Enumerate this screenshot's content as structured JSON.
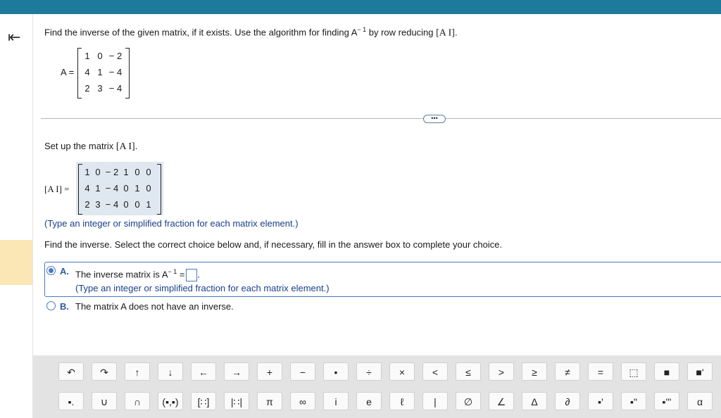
{
  "prompt": {
    "text_before": "Find the inverse of the given matrix, if it exists. Use the algorithm for finding A",
    "superscript": "− 1",
    "text_middle": " by row reducing ",
    "bracket_ai": "[A I]",
    "text_end": "."
  },
  "matrix_a": {
    "label": "A =",
    "rows": [
      [
        "1",
        "0",
        "− 2"
      ],
      [
        "4",
        "1",
        "− 4"
      ],
      [
        "2",
        "3",
        "− 4"
      ]
    ]
  },
  "setup": {
    "heading": "Set up the matrix ",
    "heading_math": "[A I]",
    "heading_end": ".",
    "label": "[A I] =",
    "rows": [
      [
        "1",
        "0",
        "− 2",
        "1",
        "0",
        "0"
      ],
      [
        "4",
        "1",
        "− 4",
        "0",
        "1",
        "0"
      ],
      [
        "2",
        "3",
        "− 4",
        "0",
        "0",
        "1"
      ]
    ],
    "hint": "(Type an integer or simplified fraction for each matrix element.)"
  },
  "find": {
    "instruction": "Find the inverse. Select the correct choice below and, if necessary, fill in the answer box to complete your choice."
  },
  "choices": [
    {
      "letter": "A.",
      "text": "The inverse matrix is A",
      "sup": "− 1",
      "eq": " =",
      "hint": "(Type an integer or simplified fraction for each matrix element.)",
      "selected": true
    },
    {
      "letter": "B.",
      "text": "The matrix A does not have an inverse.",
      "selected": false
    }
  ],
  "ellipsis": "•••",
  "toolbar_row1": [
    {
      "name": "undo-icon",
      "glyph": "↶"
    },
    {
      "name": "redo-icon",
      "glyph": "↷"
    },
    {
      "name": "arrow-up-icon",
      "glyph": "↑"
    },
    {
      "name": "arrow-down-icon",
      "glyph": "↓"
    },
    {
      "name": "arrow-left-icon",
      "glyph": "←"
    },
    {
      "name": "arrow-right-icon",
      "glyph": "→"
    },
    {
      "name": "plus-button",
      "glyph": "+"
    },
    {
      "name": "minus-button",
      "glyph": "−"
    },
    {
      "name": "dot-button",
      "glyph": "•"
    },
    {
      "name": "divide-button",
      "glyph": "÷"
    },
    {
      "name": "times-button",
      "glyph": "×"
    },
    {
      "name": "less-than-button",
      "glyph": "<"
    },
    {
      "name": "less-equal-button",
      "glyph": "≤"
    },
    {
      "name": "greater-than-button",
      "glyph": ">"
    },
    {
      "name": "greater-equal-button",
      "glyph": "≥"
    },
    {
      "name": "not-equal-button",
      "glyph": "≠"
    },
    {
      "name": "equals-button",
      "glyph": "="
    },
    {
      "name": "fraction-icon",
      "glyph": "⬚"
    },
    {
      "name": "mixed-number-icon",
      "glyph": "■"
    },
    {
      "name": "exponent-icon",
      "glyph": "■'"
    }
  ],
  "toolbar_row2": [
    {
      "name": "subscript-icon",
      "glyph": "▪."
    },
    {
      "name": "union-button",
      "glyph": "∪"
    },
    {
      "name": "intersection-button",
      "glyph": "∩"
    },
    {
      "name": "ordered-pair-button",
      "glyph": "(▪,▪)"
    },
    {
      "name": "matrix-icon",
      "glyph": "[∷]"
    },
    {
      "name": "determinant-icon",
      "glyph": "|∷|"
    },
    {
      "name": "pi-button",
      "glyph": "π"
    },
    {
      "name": "infinity-button",
      "glyph": "∞"
    },
    {
      "name": "imaginary-i-button",
      "glyph": "i"
    },
    {
      "name": "e-button",
      "glyph": "e"
    },
    {
      "name": "ell-button",
      "glyph": "ℓ"
    },
    {
      "name": "bar-button",
      "glyph": "|"
    },
    {
      "name": "empty-set-button",
      "glyph": "∅"
    },
    {
      "name": "angle-button",
      "glyph": "∠"
    },
    {
      "name": "delta-button",
      "glyph": "Δ"
    },
    {
      "name": "partial-button",
      "glyph": "∂"
    },
    {
      "name": "prime-button",
      "glyph": "▪'"
    },
    {
      "name": "double-prime-button",
      "glyph": "▪\""
    },
    {
      "name": "triple-prime-button",
      "glyph": "▪'''"
    },
    {
      "name": "alpha-button",
      "glyph": "α"
    }
  ],
  "colors": {
    "accent": "#4a78c2",
    "topbar": "#1c7a9a",
    "highlight": "#fbe7b5"
  }
}
